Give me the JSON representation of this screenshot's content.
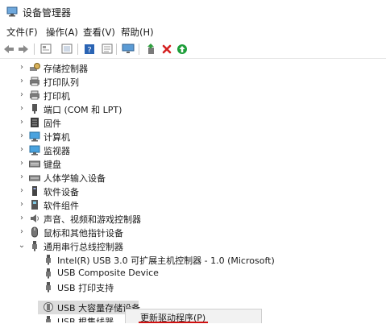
{
  "window": {
    "title": "设备管理器"
  },
  "menu": {
    "items": [
      "文件(F)",
      "操作(A)",
      "查看(V)",
      "帮助(H)"
    ]
  },
  "toolbar": {
    "icons": [
      "back-icon",
      "forward-icon",
      "properties-icon",
      "help-icon",
      "scan-icon",
      "monitor-icon",
      "update-driver-icon",
      "uninstall-icon",
      "enable-icon"
    ]
  },
  "tree": {
    "items": [
      {
        "label": "存储控制器",
        "icon": "storage-icon",
        "expanded": false
      },
      {
        "label": "打印队列",
        "icon": "printer-icon",
        "expanded": false
      },
      {
        "label": "打印机",
        "icon": "printer-icon",
        "expanded": false
      },
      {
        "label": "端口 (COM 和 LPT)",
        "icon": "port-icon",
        "expanded": false
      },
      {
        "label": "固件",
        "icon": "firmware-icon",
        "expanded": false
      },
      {
        "label": "计算机",
        "icon": "computer-icon",
        "expanded": false
      },
      {
        "label": "监视器",
        "icon": "monitor-icon",
        "expanded": false
      },
      {
        "label": "键盘",
        "icon": "keyboard-icon",
        "expanded": false
      },
      {
        "label": "人体学输入设备",
        "icon": "hid-icon",
        "expanded": false
      },
      {
        "label": "软件设备",
        "icon": "software-device-icon",
        "expanded": false
      },
      {
        "label": "软件组件",
        "icon": "software-component-icon",
        "expanded": false
      },
      {
        "label": "声音、视频和游戏控制器",
        "icon": "sound-icon",
        "expanded": false
      },
      {
        "label": "鼠标和其他指针设备",
        "icon": "mouse-icon",
        "expanded": false
      },
      {
        "label": "通用串行总线控制器",
        "icon": "usb-icon",
        "expanded": true
      }
    ],
    "children": [
      {
        "label": "Intel(R) USB 3.0 可扩展主机控制器 - 1.0 (Microsoft)"
      },
      {
        "label": "USB Composite Device"
      },
      {
        "label": "USB 打印支持"
      },
      {
        "label": "USB 大容量存储设备"
      },
      {
        "label": "USB 根集线器"
      }
    ]
  },
  "context_menu": {
    "items": [
      "更新驱动程序(P)"
    ]
  }
}
